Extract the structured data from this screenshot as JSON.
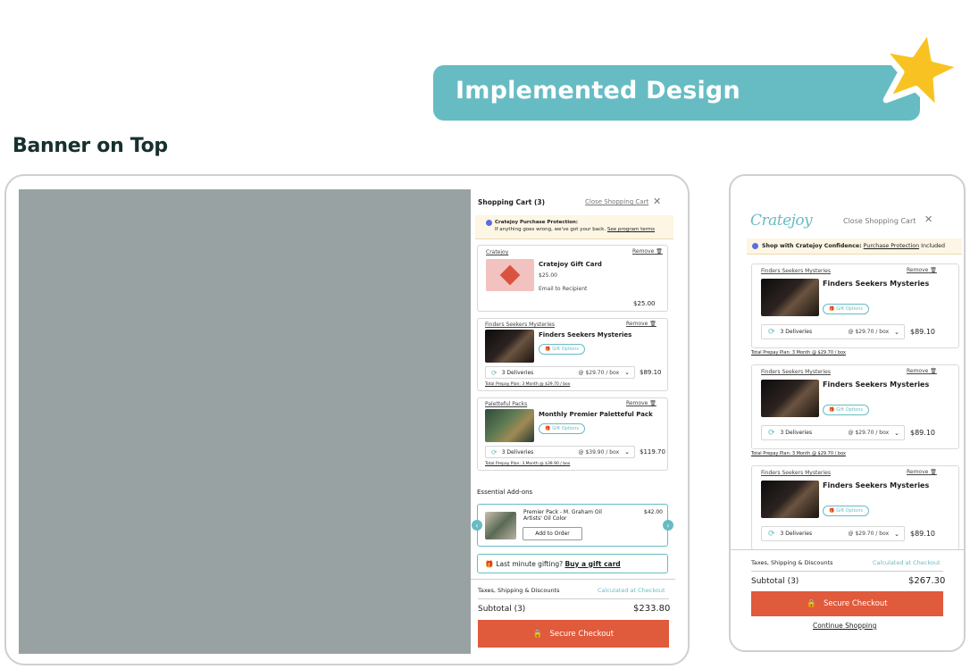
{
  "header": {
    "banner_title": "Implemented Design",
    "section_heading": "Banner on Top"
  },
  "colors": {
    "teal": "#67bcc3",
    "orange": "#e05a3c",
    "backdrop": "#98a2a2",
    "protection_bg": "#fdf6e4",
    "star": "#f8c322"
  },
  "desktop": {
    "cart_title": "Shopping Cart (3)",
    "close_link": "Close Shopping Cart",
    "protection": {
      "title": "Cratejoy Purchase Protection:",
      "text": "If anything goes wrong, we've got your back.",
      "link": "See program terms"
    },
    "items": [
      {
        "brand": "Cratejoy",
        "remove": "Remove",
        "name": "Cratejoy Gift Card",
        "price_line": "$25.00",
        "note": "Email to Recipient",
        "total": "$25.00"
      },
      {
        "brand": "Finders Seekers Mysteries",
        "remove": "Remove",
        "name": "Finders Seekers Mysteries",
        "gift_label": "Gift Options",
        "deliveries": "3 Deliveries",
        "rate": "@ $29.70 / box",
        "total": "$89.10",
        "prepay": "Total Prepay Plan: 3 Month @ $29.70 / box"
      },
      {
        "brand": "Paletteful Packs",
        "remove": "Remove",
        "name": "Monthly Premier Paletteful Pack",
        "gift_label": "Gift Options",
        "deliveries": "3 Deliveries",
        "rate": "@ $39.90 / box",
        "total": "$119.70",
        "prepay": "Total Prepay Plan: 3 Month @ $39.90 / box"
      }
    ],
    "addons": {
      "heading": "Essential Add-ons",
      "name": "Premier Pack - M. Graham Oil Artists' Oil Color",
      "price": "$42.00",
      "button": "Add to Order"
    },
    "gift_prompt": {
      "text": "Last minute gifting?",
      "link": "Buy a gift card"
    },
    "taxes_label": "Taxes, Shipping & Discounts",
    "taxes_value": "Calculated at Checkout",
    "subtotal_label": "Subtotal (3)",
    "subtotal_value": "$233.80",
    "checkout": "Secure Checkout"
  },
  "mobile": {
    "logo": "Cratejoy",
    "close_link": "Close Shopping Cart",
    "confidence_prefix": "Shop with Cratejoy Confidence:",
    "confidence_link": "Purchase Protection",
    "confidence_suffix": "Included",
    "items": [
      {
        "brand": "Finders Seekers Mysteries",
        "remove": "Remove",
        "name": "Finders Seekers Mysteries",
        "gift_label": "Gift Options",
        "deliveries": "3 Deliveries",
        "rate": "@ $29.70 / box",
        "total": "$89.10",
        "prepay": "Total Prepay Plan: 3 Month @ $29.70 / box"
      },
      {
        "brand": "Finders Seekers Mysteries",
        "remove": "Remove",
        "name": "Finders Seekers Mysteries",
        "gift_label": "Gift Options",
        "deliveries": "3 Deliveries",
        "rate": "@ $29.70 / box",
        "total": "$89.10",
        "prepay": "Total Prepay Plan: 3 Month @ $29.70 / box"
      },
      {
        "brand": "Finders Seekers Mysteries",
        "remove": "Remove",
        "name": "Finders Seekers Mysteries",
        "gift_label": "Gift Options",
        "deliveries": "3 Deliveries",
        "rate": "@ $29.70 / box",
        "total": "$89.10"
      }
    ],
    "taxes_label": "Taxes, Shipping & Discounts",
    "taxes_value": "Calculated at Checkout",
    "subtotal_label": "Subtotal (3)",
    "subtotal_value": "$267.30",
    "checkout": "Secure Checkout",
    "continue": "Continue Shopping"
  }
}
